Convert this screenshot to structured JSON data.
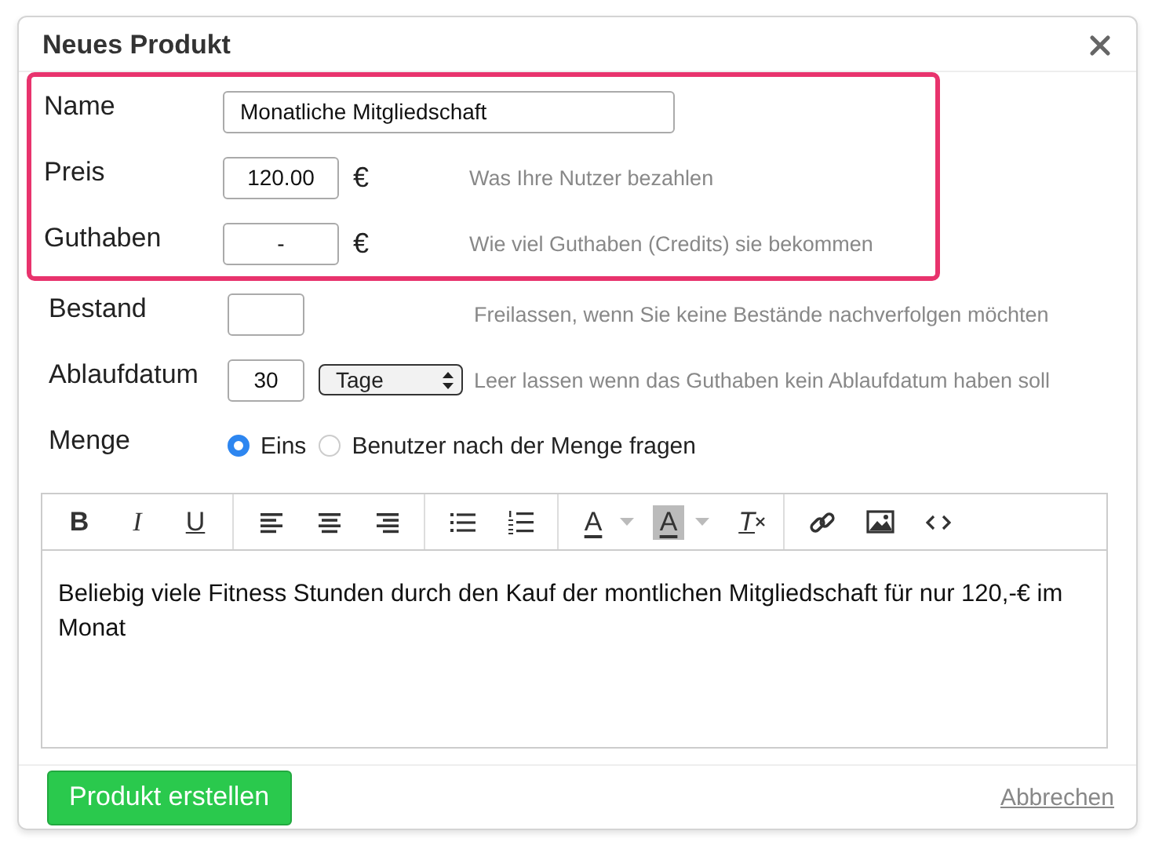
{
  "dialog": {
    "title": "Neues Produkt"
  },
  "groups": [
    {
      "highlighted": true,
      "fields": [
        {
          "kind": "wide",
          "label": "Name",
          "value": "Monatliche Mitgliedschaft"
        },
        {
          "kind": "currency",
          "label": "Preis",
          "value": "120.00",
          "currency": "€",
          "hint": "Was Ihre Nutzer bezahlen"
        },
        {
          "kind": "currency",
          "label": "Guthaben",
          "value": "-",
          "currency": "€",
          "hint": "Wie viel Guthaben (Credits) sie bekommen"
        }
      ]
    },
    {
      "highlighted": false,
      "fields": [
        {
          "kind": "short",
          "label": "Bestand",
          "hint": "Freilassen, wenn Sie keine Bestände nachverfolgen möchten"
        },
        {
          "kind": "select",
          "label": "Ablaufdatum",
          "value": "30",
          "select": "Tage",
          "hint": "Leer lassen wenn das Guthaben kein Ablaufdatum haben soll"
        },
        {
          "kind": "radio",
          "label": "Menge",
          "options": [
            {
              "label": "Eins",
              "selected": true
            },
            {
              "label": "Benutzer nach der Menge fragen",
              "selected": false
            }
          ]
        }
      ]
    }
  ],
  "toolbar": [
    [
      {
        "kind": "bold",
        "glyph": "B"
      },
      {
        "kind": "italic",
        "glyph": "I"
      },
      {
        "kind": "underline",
        "glyph": "U"
      }
    ],
    [
      {
        "kind": "align-left"
      },
      {
        "kind": "align-center"
      },
      {
        "kind": "align-right"
      }
    ],
    [
      {
        "kind": "bullet-list"
      },
      {
        "kind": "numbered-list"
      }
    ],
    [
      {
        "kind": "text-color",
        "glyph": "A"
      },
      {
        "kind": "background-color",
        "glyph": "A"
      },
      {
        "kind": "clear-format",
        "glyph": "T"
      }
    ],
    [
      {
        "kind": "link"
      },
      {
        "kind": "image"
      },
      {
        "kind": "code"
      }
    ]
  ],
  "editor": {
    "text": "Beliebig viele Fitness Stunden durch den Kauf der montlichen Mitgliedschaft für nur 120,-€ im Monat"
  },
  "footer": {
    "primary": "Produkt erstellen",
    "cancel": "Abbrechen"
  }
}
